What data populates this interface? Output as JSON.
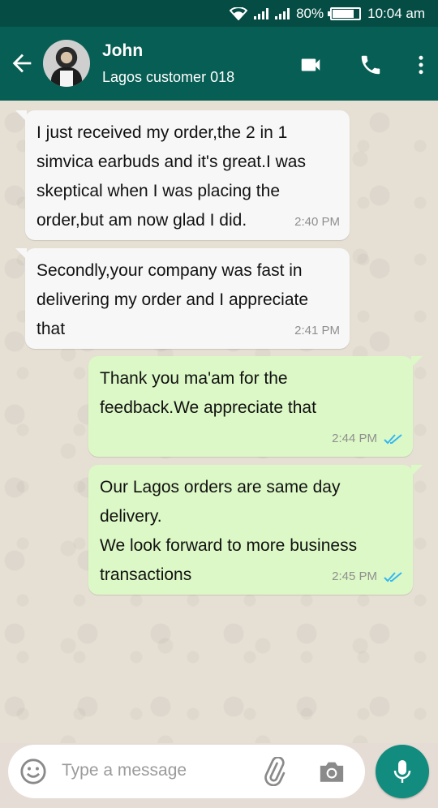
{
  "status_bar": {
    "battery": "80%",
    "time": "10:04 am",
    "battery_level": 0.8
  },
  "header": {
    "contact_name": "John",
    "contact_subtitle": "Lagos customer 018",
    "icons": [
      "back-arrow-icon",
      "video-call-icon",
      "voice-call-icon",
      "more-options-icon"
    ]
  },
  "messages": [
    {
      "direction": "incoming",
      "text": "I just received my order,the 2 in 1\nsimvica earbuds and it's great.I was\nskeptical when I was placing the\norder,but am now glad I did.",
      "time": "2:40 PM"
    },
    {
      "direction": "incoming",
      "text": "Secondly,your company was fast in\ndelivering my order and I appreciate\nthat",
      "time": "2:41 PM"
    },
    {
      "direction": "outgoing",
      "text": "Thank you ma'am for the\nfeedback.We appreciate that",
      "time": "2:44 PM",
      "status": "read"
    },
    {
      "direction": "outgoing",
      "text": "Our Lagos orders are same day\ndelivery.\nWe look forward to more business\ntransactions",
      "time": "2:45 PM",
      "status": "read"
    }
  ],
  "composer": {
    "placeholder": "Type a message"
  },
  "colors": {
    "header": "#075e54",
    "status_bar": "#054d44",
    "outgoing_bubble": "#dcf8c6",
    "incoming_bubble": "#f7f7f7",
    "mic_button": "#128c7e",
    "read_ticks": "#34b7f1"
  }
}
